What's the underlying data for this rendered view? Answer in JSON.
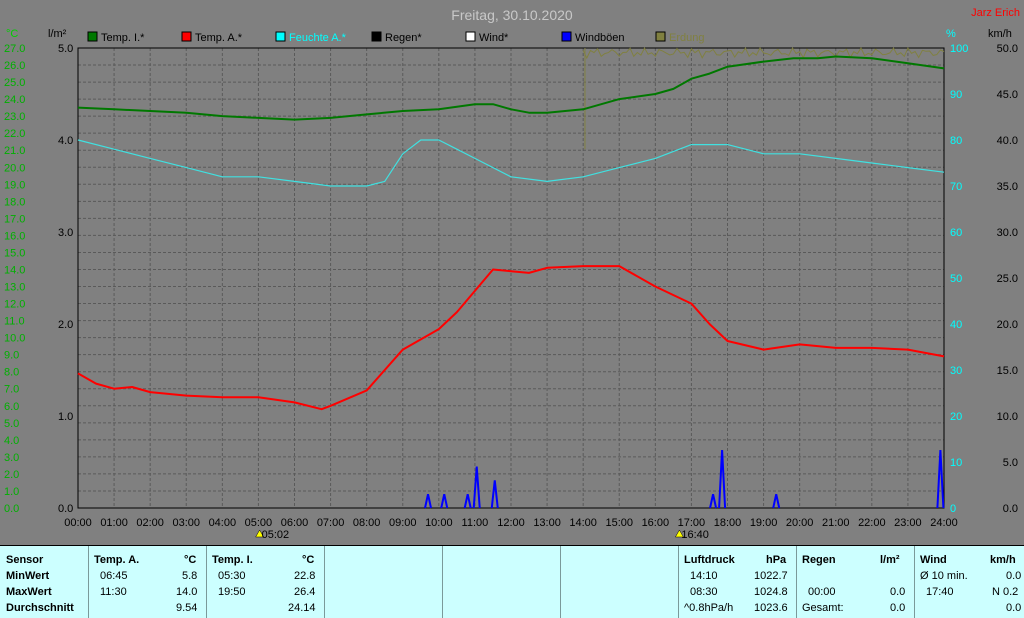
{
  "title": "Freitag, 30.10.2020",
  "author": "Jarz Erich",
  "axes": {
    "left_temp_unit": "°C",
    "left_rain_unit": "l/m²",
    "right_hum_unit": "%",
    "right_wind_unit": "km/h",
    "temp_ticks": [
      "27.0",
      "26.0",
      "25.0",
      "24.0",
      "23.0",
      "22.0",
      "21.0",
      "20.0",
      "19.0",
      "18.0",
      "17.0",
      "16.0",
      "15.0",
      "14.0",
      "13.0",
      "12.0",
      "11.0",
      "10.0",
      "9.0",
      "8.0",
      "7.0",
      "6.0",
      "5.0",
      "4.0",
      "3.0",
      "2.0",
      "1.0",
      "0.0"
    ],
    "rain_ticks": [
      "5.0",
      "4.0",
      "3.0",
      "2.0",
      "1.0",
      "0.0"
    ],
    "hum_ticks": [
      "100",
      "90",
      "80",
      "70",
      "60",
      "50",
      "40",
      "30",
      "20",
      "10",
      "0"
    ],
    "wind_ticks": [
      "50.0",
      "45.0",
      "40.0",
      "35.0",
      "30.0",
      "25.0",
      "20.0",
      "15.0",
      "10.0",
      "5.0",
      "0.0"
    ],
    "time_ticks": [
      "00:00",
      "01:00",
      "02:00",
      "03:00",
      "04:00",
      "05:00",
      "06:00",
      "07:00",
      "08:00",
      "09:00",
      "10:00",
      "11:00",
      "12:00",
      "13:00",
      "14:00",
      "15:00",
      "16:00",
      "17:00",
      "18:00",
      "19:00",
      "20:00",
      "21:00",
      "22:00",
      "23:00",
      "24:00"
    ]
  },
  "legend": [
    {
      "label": "Temp. I.*",
      "color": "#007800"
    },
    {
      "label": "Temp. A.*",
      "color": "#ff0000"
    },
    {
      "label": "Feuchte A.*",
      "color": "#00ffff"
    },
    {
      "label": "Regen*",
      "color": "#000000"
    },
    {
      "label": "Wind*",
      "color": "#ffffff"
    },
    {
      "label": "Windböen",
      "color": "#0000ff"
    },
    {
      "label": "Erdung",
      "color": "#808040"
    }
  ],
  "sun": {
    "sunrise": "05:02",
    "sunset": "16:40"
  },
  "colors": {
    "temp_in": "#007800",
    "temp_out": "#ff0000",
    "humidity": "#40e0e0",
    "gust": "#0000ff",
    "ground": "#808040",
    "plot_bg": "#808080",
    "grid": "#5a5a5a",
    "temp_axis": "#00b000",
    "hum_axis": "#00ffff",
    "table_bg": "#ccffff"
  },
  "chart_data": {
    "type": "line",
    "title": "Freitag, 30.10.2020",
    "x_range_hours": [
      0,
      24
    ],
    "temp_range": [
      0,
      27
    ],
    "rain_range": [
      0,
      5
    ],
    "humidity_range": [
      0,
      100
    ],
    "wind_range": [
      0,
      50
    ],
    "series": [
      {
        "name": "Temp. I.*",
        "axis": "temp",
        "points": [
          [
            0,
            23.5
          ],
          [
            1,
            23.4
          ],
          [
            2,
            23.3
          ],
          [
            3,
            23.2
          ],
          [
            4,
            23.0
          ],
          [
            5,
            22.9
          ],
          [
            6,
            22.8
          ],
          [
            7,
            22.9
          ],
          [
            8,
            23.1
          ],
          [
            9,
            23.3
          ],
          [
            10,
            23.4
          ],
          [
            11,
            23.7
          ],
          [
            11.5,
            23.7
          ],
          [
            12,
            23.4
          ],
          [
            12.5,
            23.2
          ],
          [
            13,
            23.2
          ],
          [
            14,
            23.4
          ],
          [
            15,
            24.0
          ],
          [
            16,
            24.3
          ],
          [
            16.5,
            24.6
          ],
          [
            17,
            25.2
          ],
          [
            17.5,
            25.5
          ],
          [
            18,
            25.9
          ],
          [
            19,
            26.2
          ],
          [
            19.83,
            26.4
          ],
          [
            20.5,
            26.4
          ],
          [
            21,
            26.5
          ],
          [
            22,
            26.4
          ],
          [
            23,
            26.1
          ],
          [
            24,
            25.8
          ]
        ]
      },
      {
        "name": "Temp. A.*",
        "axis": "temp",
        "points": [
          [
            0,
            7.9
          ],
          [
            0.5,
            7.3
          ],
          [
            1,
            7.0
          ],
          [
            1.5,
            7.1
          ],
          [
            2,
            6.8
          ],
          [
            3,
            6.6
          ],
          [
            4,
            6.5
          ],
          [
            5,
            6.5
          ],
          [
            6,
            6.2
          ],
          [
            6.75,
            5.8
          ],
          [
            7,
            6.0
          ],
          [
            8,
            6.9
          ],
          [
            9,
            9.3
          ],
          [
            10,
            10.5
          ],
          [
            10.5,
            11.5
          ],
          [
            11.5,
            14.0
          ],
          [
            12,
            13.9
          ],
          [
            12.5,
            13.8
          ],
          [
            13,
            14.1
          ],
          [
            14,
            14.2
          ],
          [
            15,
            14.2
          ],
          [
            16,
            13.0
          ],
          [
            17,
            12.0
          ],
          [
            17.5,
            10.8
          ],
          [
            18,
            9.8
          ],
          [
            19,
            9.3
          ],
          [
            20,
            9.6
          ],
          [
            21,
            9.4
          ],
          [
            22,
            9.4
          ],
          [
            23,
            9.3
          ],
          [
            24,
            8.9
          ]
        ]
      },
      {
        "name": "Feuchte A.*",
        "axis": "humidity",
        "points": [
          [
            0,
            80
          ],
          [
            1,
            78
          ],
          [
            2,
            76
          ],
          [
            3,
            74
          ],
          [
            4,
            72
          ],
          [
            5,
            72
          ],
          [
            6,
            71
          ],
          [
            7,
            70
          ],
          [
            8,
            70
          ],
          [
            8.5,
            71
          ],
          [
            9,
            77
          ],
          [
            9.5,
            80
          ],
          [
            10,
            80
          ],
          [
            10.5,
            78
          ],
          [
            11,
            76
          ],
          [
            12,
            72
          ],
          [
            13,
            71
          ],
          [
            14,
            72
          ],
          [
            15,
            74
          ],
          [
            16,
            76
          ],
          [
            17,
            79
          ],
          [
            17.5,
            79
          ],
          [
            18,
            79
          ],
          [
            19,
            77
          ],
          [
            20,
            77
          ],
          [
            21,
            76
          ],
          [
            22,
            75
          ],
          [
            23,
            74
          ],
          [
            24,
            73
          ]
        ]
      },
      {
        "name": "Windböen",
        "axis": "wind",
        "spikes": [
          [
            9.7,
            1.5
          ],
          [
            10.15,
            1.5
          ],
          [
            10.8,
            1.5
          ],
          [
            11.05,
            4.5
          ],
          [
            11.55,
            3.0
          ],
          [
            17.6,
            1.5
          ],
          [
            17.85,
            6.3
          ],
          [
            19.35,
            1.5
          ],
          [
            23.9,
            6.3
          ]
        ]
      }
    ]
  },
  "table": {
    "sensor": {
      "header": "Sensor",
      "rows": [
        "MinWert",
        "MaxWert",
        "Durchschnitt"
      ]
    },
    "temp_out": {
      "header": "Temp. A.",
      "unit": "°C",
      "rows": [
        [
          "06:45",
          "5.8"
        ],
        [
          "11:30",
          "14.0"
        ],
        [
          "",
          "9.54"
        ]
      ]
    },
    "temp_in": {
      "header": "Temp. I.",
      "unit": "°C",
      "rows": [
        [
          "05:30",
          "22.8"
        ],
        [
          "19:50",
          "26.4"
        ],
        [
          "",
          "24.14"
        ]
      ]
    },
    "pressure": {
      "header": "Luftdruck",
      "unit": "hPa",
      "rows": [
        [
          "14:10",
          "1022.7"
        ],
        [
          "08:30",
          "1024.8"
        ],
        [
          "^0.8hPa/h",
          "1023.6"
        ]
      ]
    },
    "rain": {
      "header": "Regen",
      "unit": "l/m²",
      "rows": [
        [
          "",
          ""
        ],
        [
          "00:00",
          "0.0"
        ],
        [
          "Gesamt:",
          "0.0"
        ]
      ]
    },
    "wind": {
      "header": "Wind",
      "unit": "km/h",
      "rows": [
        [
          "Ø 10 min.",
          "0.0"
        ],
        [
          "17:40",
          "N 0.2"
        ],
        [
          "",
          "0.0"
        ]
      ]
    }
  }
}
